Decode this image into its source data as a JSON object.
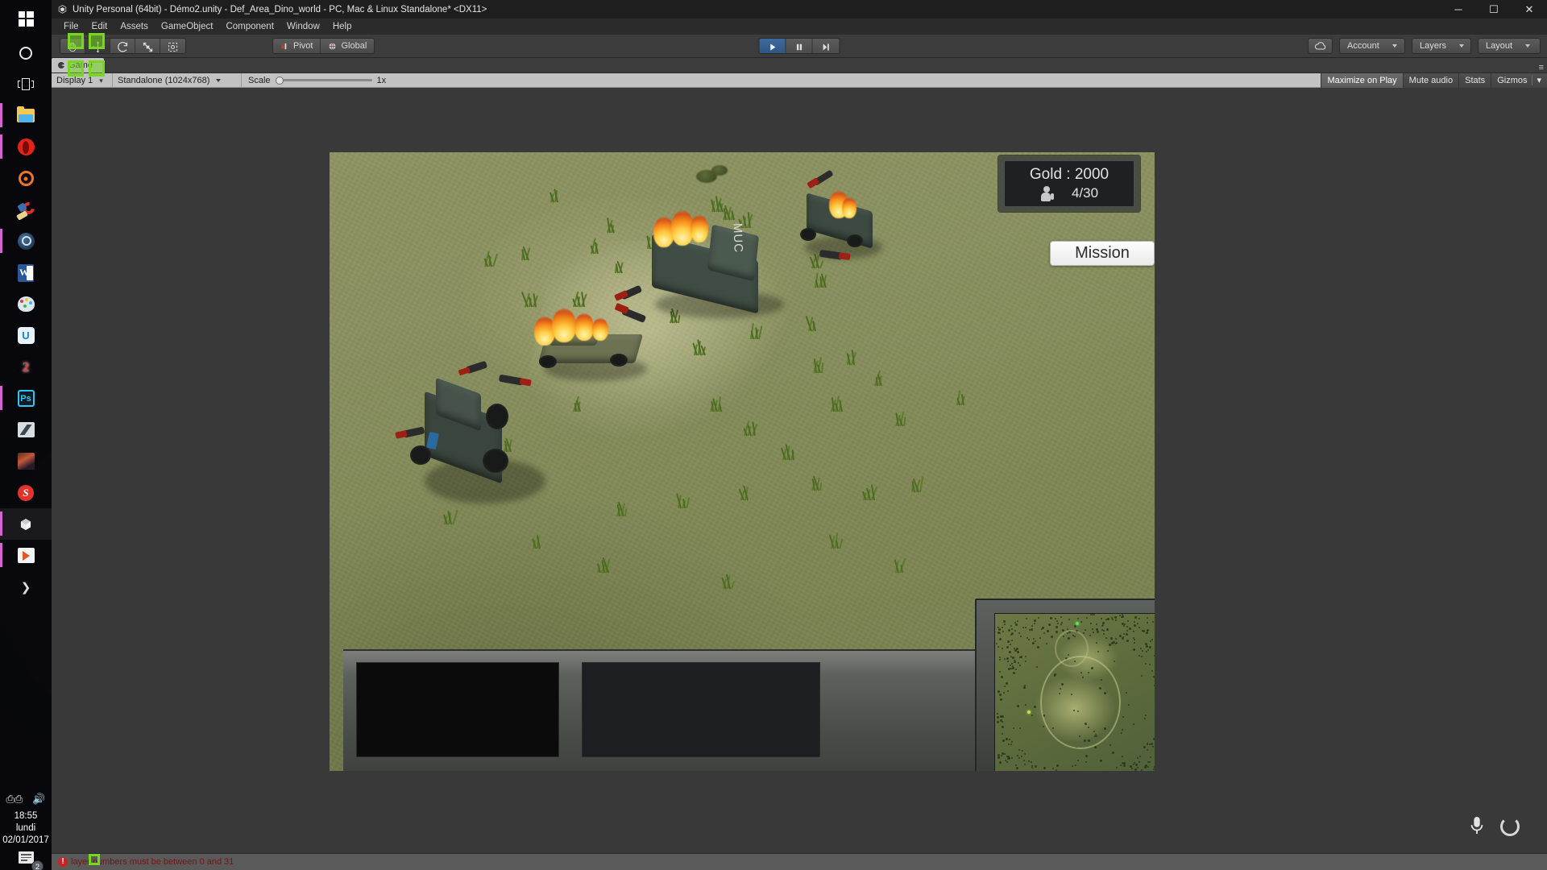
{
  "window": {
    "title": "Unity Personal (64bit) - Démo2.unity - Def_Area_Dino_world - PC, Mac & Linux Standalone* <DX11>",
    "app_icon": "unity-icon",
    "minimize_label": "─",
    "maximize_label": "☐",
    "close_label": "✕"
  },
  "menubar": {
    "items": [
      {
        "label": "File"
      },
      {
        "label": "Edit"
      },
      {
        "label": "Assets"
      },
      {
        "label": "GameObject"
      },
      {
        "label": "Component"
      },
      {
        "label": "Window"
      },
      {
        "label": "Help"
      }
    ]
  },
  "toolbar": {
    "transform_tools": [
      {
        "name": "hand-tool",
        "icon": "hand-icon",
        "selected": false
      },
      {
        "name": "move-tool",
        "icon": "move-arrows-icon",
        "selected": true
      },
      {
        "name": "rotate-tool",
        "icon": "rotate-icon",
        "selected": false
      },
      {
        "name": "scale-tool",
        "icon": "scale-icon",
        "selected": false
      },
      {
        "name": "rect-tool",
        "icon": "rect-transform-icon",
        "selected": false
      }
    ],
    "pivot_label": "Pivot",
    "global_label": "Global",
    "play_label": "▶",
    "pause_label": "‖",
    "step_label": "▶|",
    "cloud_icon": "cloud-icon",
    "account_label": "Account",
    "layers_label": "Layers",
    "layout_label": "Layout"
  },
  "gameview": {
    "tab_label": "Game",
    "display_label": "Display 1",
    "aspect_label": "Standalone (1024x768)",
    "scale_label": "Scale",
    "scale_value": "1x",
    "maximize_label": "Maximize on Play",
    "mute_label": "Mute audio",
    "stats_label": "Stats",
    "gizmos_label": "Gizmos"
  },
  "hud": {
    "gold_label": "Gold : 2000",
    "population_icon": "population-icon",
    "population_label": "4/30",
    "mission_label": "Mission"
  },
  "statusbar": {
    "error_icon": "error-icon",
    "error_badge": "!",
    "message": "layer numbers must be between 0 and 31"
  },
  "taskbar": {
    "items": [
      {
        "name": "start-button",
        "icon": "windows-logo-icon"
      },
      {
        "name": "cortana-button",
        "icon": "circle-icon"
      },
      {
        "name": "task-view-button",
        "icon": "task-view-icon"
      },
      {
        "name": "file-explorer",
        "icon": "folder-icon"
      },
      {
        "name": "opera-browser",
        "icon": "opera-icon"
      },
      {
        "name": "origin-launcher",
        "icon": "origin-icon"
      },
      {
        "name": "ccleaner",
        "icon": "ccleaner-icon"
      },
      {
        "name": "steam-client",
        "icon": "steam-icon"
      },
      {
        "name": "microsoft-word",
        "icon": "word-icon"
      },
      {
        "name": "paint",
        "icon": "paint-palette-icon"
      },
      {
        "name": "uplay-launcher",
        "icon": "uplay-icon"
      },
      {
        "name": "game-shortcut",
        "icon": "game2-icon"
      },
      {
        "name": "photoshop",
        "icon": "photoshop-icon"
      },
      {
        "name": "dark-app",
        "icon": "dark-app-icon"
      },
      {
        "name": "hero-game",
        "icon": "hero-thumbnail-icon"
      },
      {
        "name": "s-app",
        "icon": "s-logo-icon"
      },
      {
        "name": "unity-editor",
        "icon": "unity-icon"
      },
      {
        "name": "media-player",
        "icon": "media-play-icon"
      },
      {
        "name": "taskbar-overflow",
        "icon": "chevron-right-icon"
      }
    ],
    "tray": [
      {
        "name": "tray-keyboard",
        "icon": "keyboard-icon"
      },
      {
        "name": "tray-volume",
        "icon": "speaker-icon"
      }
    ],
    "clock": {
      "time": "18:55",
      "day": "lundi",
      "date": "02/01/2017"
    },
    "notifications": {
      "icon": "notification-icon",
      "count": "2"
    }
  },
  "overlay": {
    "mic_icon": "microphone-icon",
    "record_icon": "record-ring-icon"
  },
  "colors": {
    "unity_chrome": "#3c3c3c",
    "unity_titlebar": "#1e1e1e",
    "gameview_bar": "#c2c2c2",
    "annotation_green": "#77d61e",
    "error_red": "#cc2222",
    "minimap_blip": "#5ee24a"
  }
}
